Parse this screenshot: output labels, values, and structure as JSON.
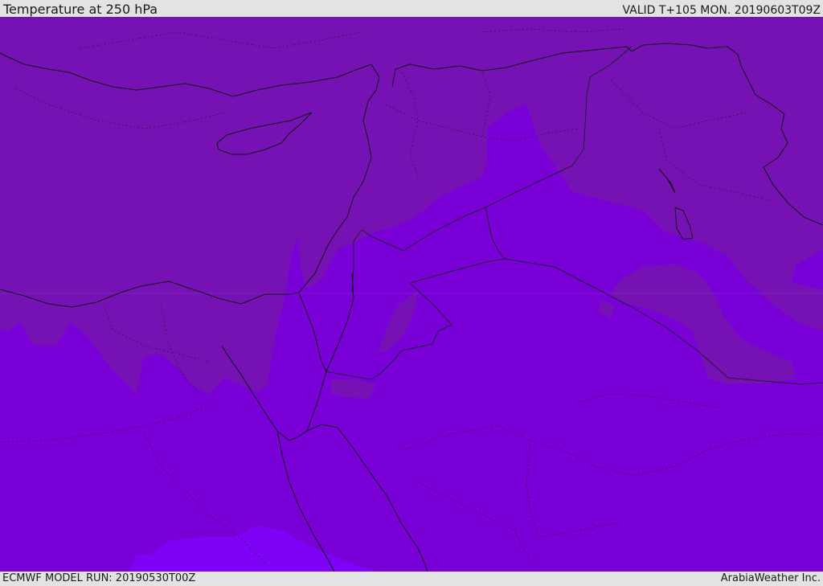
{
  "header": {
    "title": "Temperature at 250 hPa",
    "valid_time": "VALID T+105 MON. 20190603T09Z"
  },
  "footer": {
    "model_run": "ECMWF MODEL RUN: 20190530T00Z",
    "credit": "ArabiaWeather Inc."
  },
  "map": {
    "field": "Temperature at 250 hPa",
    "region": "Eastern Mediterranean and Middle East",
    "colors": {
      "cold_zone": "#7612b4",
      "mid_zone": "#7a00d8",
      "warm_zone": "#7e02f6",
      "coastline": "#111111",
      "border": "#1e1e2e"
    }
  }
}
